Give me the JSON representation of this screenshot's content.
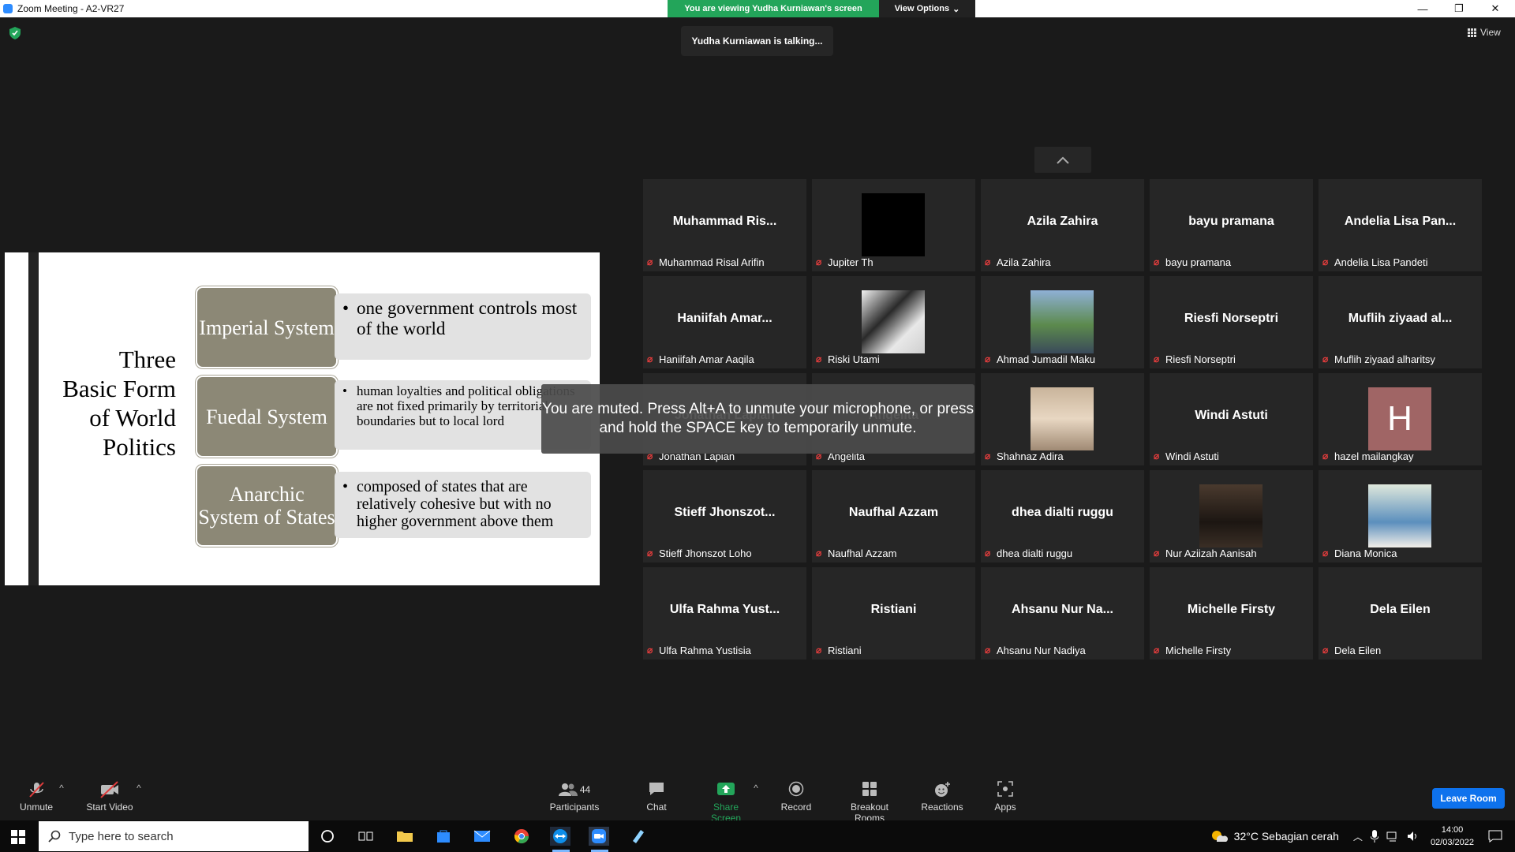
{
  "window": {
    "title": "Zoom Meeting - A2-VR27",
    "minimize": "—",
    "restore": "❐",
    "close": "✕"
  },
  "banner": {
    "viewing": "You are viewing Yudha Kurniawan's screen",
    "view_options": "View Options",
    "chevron": "⌄"
  },
  "talking": "Yudha Kurniawan is talking...",
  "view_button": {
    "label": "View",
    "icon": "grid-icon"
  },
  "slide": {
    "title": "Three Basic Form of World Politics",
    "rows": [
      {
        "system": "Imperial System",
        "desc": "one government controls most of the world"
      },
      {
        "system": "Fuedal System",
        "desc": "human loyalties and political obligations are not fixed primarily by territorial boundaries but to local lord"
      },
      {
        "system": "Anarchic System of States",
        "desc": "composed of states that are relatively cohesive but with no higher government above them"
      }
    ]
  },
  "muted_notice": "You are muted. Press Alt+A to unmute your microphone, or press and hold the SPACE key to temporarily unmute.",
  "grid_up_icon": "chevron-up-icon",
  "participants": [
    {
      "big": "Muhammad  Ris...",
      "name": "Muhammad Risal Arifin"
    },
    {
      "big": "",
      "name": "Jupiter Th",
      "media": "black"
    },
    {
      "big": "Azila Zahira",
      "name": "Azila Zahira"
    },
    {
      "big": "bayu pramana",
      "name": "bayu pramana"
    },
    {
      "big": "Andelia Lisa Pan...",
      "name": "Andelia Lisa Pandeti"
    },
    {
      "big": "Haniifah  Amar...",
      "name": "Haniifah Amar Aaqila"
    },
    {
      "big": "",
      "name": "Riski Utami",
      "media": "photo-dog"
    },
    {
      "big": "",
      "name": "Ahmad Jumadil Maku",
      "media": "photo-outdoor"
    },
    {
      "big": "Riesfi Norseptri",
      "name": "Riesfi Norseptri"
    },
    {
      "big": "Muflih ziyaad al...",
      "name": "Muflih ziyaad alharitsy"
    },
    {
      "big": "Jonathan Lapian",
      "name": "Jonathan Lapian"
    },
    {
      "big": "Angelita",
      "name": "Angelita"
    },
    {
      "big": "",
      "name": "Shahnaz Adira",
      "media": "photo-hair"
    },
    {
      "big": "Windi Astuti",
      "name": "Windi Astuti"
    },
    {
      "big": "",
      "name": "hazel mailangkay",
      "avatar": "H"
    },
    {
      "big": "Stieff  Jhonszot...",
      "name": "Stieff Jhonszot Loho"
    },
    {
      "big": "Naufhal Azzam",
      "name": "Naufhal Azzam"
    },
    {
      "big": "dhea dialti ruggu",
      "name": "dhea dialti ruggu"
    },
    {
      "big": "",
      "name": "Nur Aziizah Aanisah",
      "media": "photo-room"
    },
    {
      "big": "",
      "name": "Diana Monica",
      "media": "photo-flowers"
    },
    {
      "big": "Ulfa Rahma Yust...",
      "name": "Ulfa Rahma Yustisia"
    },
    {
      "big": "Ristiani",
      "name": "Ristiani"
    },
    {
      "big": "Ahsanu Nur Na...",
      "name": "Ahsanu Nur Nadiya"
    },
    {
      "big": "Michelle Firsty",
      "name": "Michelle Firsty"
    },
    {
      "big": "Dela Eilen",
      "name": "Dela Eilen"
    }
  ],
  "toolbar": {
    "unmute": "Unmute",
    "start_video": "Start Video",
    "participants": "Participants",
    "participants_count": "44",
    "chat": "Chat",
    "share_screen": "Share Screen",
    "record": "Record",
    "breakout": "Breakout Rooms",
    "reactions": "Reactions",
    "apps": "Apps",
    "leave": "Leave Room",
    "caret": "^"
  },
  "taskbar": {
    "search_placeholder": "Type here to search",
    "weather": "32°C  Sebagian cerah",
    "time": "14:00",
    "date": "02/03/2022"
  },
  "colors": {
    "share_green": "#23a55a",
    "leave_blue": "#0e72ed",
    "muted_red": "#e03c3c",
    "slide_box": "#8c8876"
  }
}
